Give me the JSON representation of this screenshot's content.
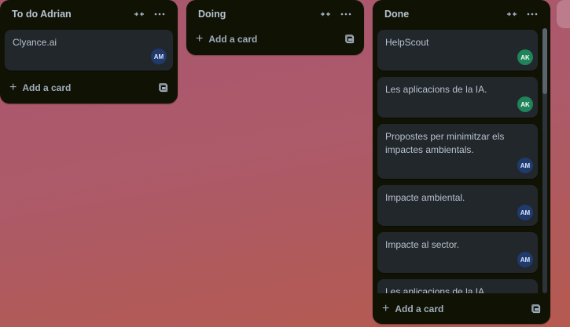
{
  "lists": [
    {
      "title": "To do Adrian",
      "cards": [
        {
          "title": "Clyance.ai",
          "member": "AM"
        }
      ],
      "add_label": "Add a card"
    },
    {
      "title": "Doing",
      "cards": [],
      "add_label": "Add a card"
    },
    {
      "title": "Done",
      "cards": [
        {
          "title": "HelpScout",
          "member": "AK"
        },
        {
          "title": "Les aplicacions de la IA.",
          "member": "AK"
        },
        {
          "title": "Propostes per minimitzar els impactes ambientals.",
          "member": "AM"
        },
        {
          "title": "Impacte ambiental.",
          "member": "AM"
        },
        {
          "title": "Impacte al sector.",
          "member": "AM"
        },
        {
          "title": "Les aplicacions de la IA."
        }
      ],
      "add_label": "Add a card"
    }
  ],
  "icons": {
    "collapse": "collapse-icon",
    "more": "more-options-icon",
    "plus": "plus-icon",
    "template": "card-template-icon"
  },
  "colors": {
    "list_bg": "#101204",
    "card_bg": "#22272b",
    "avatar_am": "#1f3a6b",
    "avatar_ak": "#1f845a"
  }
}
